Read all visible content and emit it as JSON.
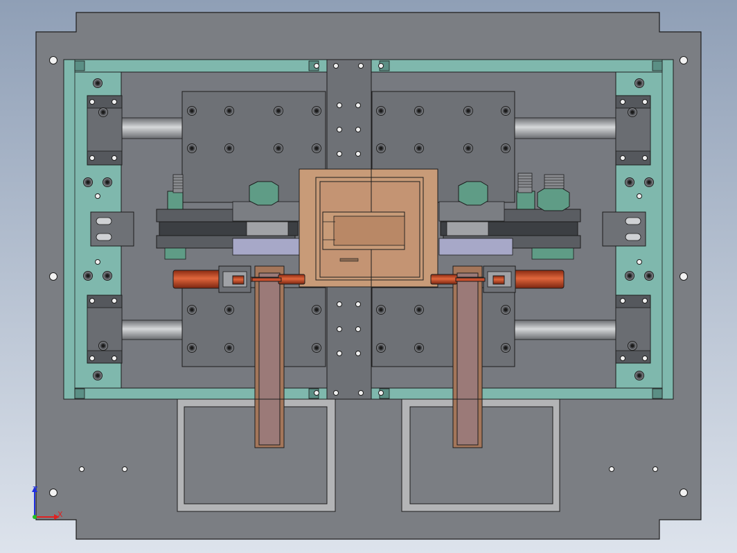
{
  "viewport": {
    "background_top": "#8f9fb6",
    "background_bottom": "#dde3ec"
  },
  "colors": {
    "base_plate": "#7b7e83",
    "frame_teal": "#7fb8ad",
    "block_gray": "#6e7176",
    "dark_gray": "#55585d",
    "copper": "#c89b78",
    "copper_dark": "#a4765a",
    "cylinder_red": "#c9502e",
    "nut_green": "#5f9c86",
    "rod_steel": "#a9abae",
    "channel_mauve": "#9b7a78",
    "outline": "#1c1c1c"
  },
  "triad": {
    "x_label": "X",
    "y_label": "Z",
    "x_color": "#e02020",
    "y_color": "#2030e0"
  }
}
